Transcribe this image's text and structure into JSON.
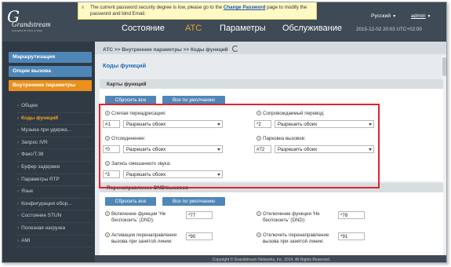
{
  "header": {
    "logo": {
      "word": "Grandstream",
      "tag": "Innovative IP Voice & Video"
    },
    "notice": {
      "close": "x",
      "text_before": "The current password security degree is low, please go to the ",
      "link": "Change Password",
      "text_after": " page to modify the password and bind Email."
    },
    "nav": [
      {
        "label": "Состояние",
        "active": false
      },
      {
        "label": "АТС",
        "active": true
      },
      {
        "label": "Параметры",
        "active": false
      },
      {
        "label": "Обслуживание",
        "active": false
      }
    ],
    "language": "Русский",
    "user": "admin",
    "datetime": "2015-12-02 20:03 UTC+02:00"
  },
  "sidebar": {
    "sections": [
      {
        "label": "Маршрутизация",
        "active": false
      },
      {
        "label": "Опции вызова",
        "active": false
      },
      {
        "label": "Внутренние параметры",
        "active": true
      }
    ],
    "items": [
      {
        "label": "Общее",
        "active": false
      },
      {
        "label": "Коды функций",
        "active": true
      },
      {
        "label": "Музыка при удержа...",
        "active": false
      },
      {
        "label": "Запрос IVR",
        "active": false
      },
      {
        "label": "Факс/Т.38",
        "active": false
      },
      {
        "label": "Буфер задержки",
        "active": false
      },
      {
        "label": "Параметры RTP",
        "active": false
      },
      {
        "label": "Язык",
        "active": false
      },
      {
        "label": "Конфигурация обор...",
        "active": false
      },
      {
        "label": "Состояние STUN",
        "active": false
      },
      {
        "label": "Полезная нагрузка",
        "active": false
      },
      {
        "label": "AMI",
        "active": false
      }
    ]
  },
  "main": {
    "breadcrumb": "АТС >> Внутренние параметры >> Коды функций",
    "title": "Коды функций",
    "feature_maps": {
      "heading": "Карты функций",
      "reset_all": "Сбросить все",
      "defaults": "Все по умолчанию",
      "fields": [
        {
          "label": "Слепая переадресация:",
          "code": "#1",
          "option": "Разрешить обоих"
        },
        {
          "label": "Сопровождаемый перевод:",
          "code": "*2",
          "option": "Разрешить обоих"
        },
        {
          "label": "Отсоединение:",
          "code": "*0",
          "option": "Разрешить обоих"
        },
        {
          "label": "Парковка вызовов:",
          "code": "#72",
          "option": "Разрешить обоих"
        },
        {
          "label": "Запись смешанного звука:",
          "code": "*3",
          "option": "Разрешить обоих"
        }
      ]
    },
    "dnd": {
      "heading": "Перенаправление DND/вызовов",
      "reset_all": "Сбросить все",
      "defaults": "Все по умолчанию",
      "fields": [
        {
          "label_1": "Включение функции 'Не",
          "label_2": "беспокоить' (DND):",
          "code": "*77"
        },
        {
          "label_1": "Отключение функции 'Не",
          "label_2": "беспокоить' (DND):",
          "code": "*78"
        },
        {
          "label_1": "Активация перенаправления",
          "label_2": "вызова при занятой линии:",
          "code": "*90"
        },
        {
          "label_1": "Отключить перенаправление",
          "label_2": "вызова при занятой линии:",
          "code": "*91"
        }
      ]
    }
  },
  "footer": "Copyright © Grandstream Networks, Inc. 2014. All Rights Reserved.",
  "colors": {
    "accent": "#e9901f",
    "button": "#4f86b8",
    "highlight": "#e0232b",
    "header": "#3e4a55"
  }
}
